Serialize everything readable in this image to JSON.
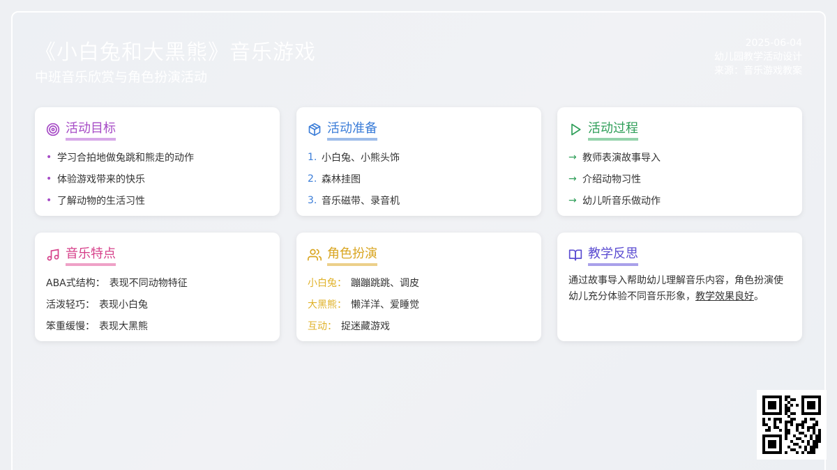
{
  "header": {
    "title": "《小白兔和大黑熊》音乐游戏",
    "subtitle": "中班音乐欣赏与角色扮演活动",
    "date": "2025-06-04",
    "type": "幼儿园教学活动设计",
    "source": "来源：音乐游戏教案"
  },
  "colors": {
    "purple": "#a64bc6",
    "blue": "#3b7dd8",
    "green": "#2e9e58",
    "pink": "#d6408a",
    "gold": "#d9a520",
    "indigo": "#5a4bd1"
  },
  "cards": {
    "goals": {
      "title": "活动目标",
      "icon": "target-icon",
      "items": [
        "学习合拍地做兔跳和熊走的动作",
        "体验游戏带来的快乐",
        "了解动物的生活习性"
      ]
    },
    "prep": {
      "title": "活动准备",
      "icon": "box-icon",
      "items": [
        "小白兔、小熊头饰",
        "森林挂图",
        "音乐磁带、录音机"
      ]
    },
    "process": {
      "title": "活动过程",
      "icon": "play-icon",
      "items": [
        "教师表演故事导入",
        "介绍动物习性",
        "幼儿听音乐做动作"
      ]
    },
    "music": {
      "title": "音乐特点",
      "icon": "music-note-icon",
      "items": [
        {
          "label": "ABA式结构：",
          "value": "表现不同动物特征"
        },
        {
          "label": "活泼轻巧：",
          "value": "表现小白兔"
        },
        {
          "label": "笨重缓慢：",
          "value": "表现大黑熊"
        }
      ]
    },
    "roles": {
      "title": "角色扮演",
      "icon": "users-icon",
      "items": [
        {
          "label": "小白兔：",
          "value": "蹦蹦跳跳、调皮"
        },
        {
          "label": "大黑熊：",
          "value": "懒洋洋、爱睡觉"
        },
        {
          "label": "互动：",
          "value": "捉迷藏游戏"
        }
      ]
    },
    "reflection": {
      "title": "教学反思",
      "icon": "book-open-icon",
      "text_before": "通过故事导入帮助幼儿理解音乐内容，角色扮演使幼儿充分体验不同音乐形象，",
      "text_underlined": "教学效果良好",
      "text_after": "。"
    }
  },
  "numbers": [
    "1.",
    "2.",
    "3."
  ],
  "arrow": "→",
  "dot": "•"
}
